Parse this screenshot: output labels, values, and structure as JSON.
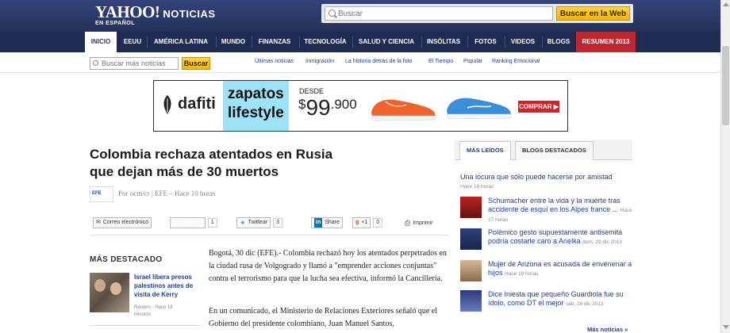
{
  "header": {
    "logo": "YAHOO!",
    "section": "NOTICIAS",
    "edition": "EN ESPAÑOL",
    "search_placeholder": "Buscar",
    "search_button": "Buscar en la Web"
  },
  "nav": {
    "items": [
      "INICIO",
      "EEUU",
      "AMÉRICA LATINA",
      "MUNDO",
      "FINANZAS",
      "TECNOLOGÍA",
      "SALUD Y CIENCIA",
      "INSÓLITAS",
      "FOTOS",
      "VIDEOS",
      "BLOGS",
      "RESUMEN 2013"
    ]
  },
  "subnav": {
    "search_placeholder": "Buscar más noticias",
    "search_button": "Buscar",
    "links": [
      "Últimas noticias",
      "Inmigración",
      "La historia detrás de la foto",
      "El Tiempo",
      "Popular",
      "Ranking Emocional"
    ]
  },
  "ad": {
    "brand": "dafiti",
    "line1": "zapatos",
    "line2": "lifestyle",
    "desde": "DESDE",
    "currency": "$",
    "price_main": "99",
    "price_cents": ".900",
    "cta": "COMPRAR ▶"
  },
  "article": {
    "title": "Colombia rechaza atentados en Rusia que dejan más de 30 muertos",
    "agency_logo": "EFE",
    "byline": "Por ocm/cr | EFE – Hace 10 horas",
    "share": {
      "email": "Correo electrónico",
      "facebook": "Compartir",
      "facebook_count": "1",
      "twitter": "Twittear",
      "twitter_count": "3",
      "linkedin": "Share",
      "gplus": "+1",
      "gplus_count": "0",
      "print": "Imprimir"
    },
    "paragraph1": "Bogotá, 30 dic (EFE).- Colombia rechazó hoy los atentados perpetrados en la ciudad rusa de Volgogrado y llamó a \"emprender acciones conjuntas\" contra el terrorismo para que la lucha sea efectiva, informó la Cancillería.",
    "paragraph2": "En un comunicado, el Ministerio de Relaciones Exteriores señaló que el Gobierno del presidente colombiano, Juan Manuel Santos,"
  },
  "mas_destacado": {
    "title": "MÁS DESTACADO",
    "headline": "Israel libera presos palestinos antes de visita de Kerry",
    "source": "Reuters - Hace 18 minutos"
  },
  "sidebar": {
    "tab_active": "MÁS LEÍDOS",
    "tab_inactive": "BLOGS DESTACADOS",
    "top_story": "Una locura que sólo puede hacerse por amistad",
    "top_time": "Hace 18 horas",
    "items": [
      {
        "text": "Schumacher entre la vida y la muerte tras accidente de esquí en los Alpes france ...",
        "time": "Hace 17 horas"
      },
      {
        "text": "Polémico gesto supuestamente antisemita podría costarle caro a Anelka",
        "time": "dom, 29 dic 2013"
      },
      {
        "text": "Mujer de Arizona es acusada de envenenar a hijos",
        "time": "Hace 19 horas"
      },
      {
        "text": "Dice Iniesta que pequeño Guardiola fue su ídolo, como DT el mejor",
        "time": "sáb, 28 dic 2013"
      }
    ],
    "more": "Más noticias »"
  }
}
